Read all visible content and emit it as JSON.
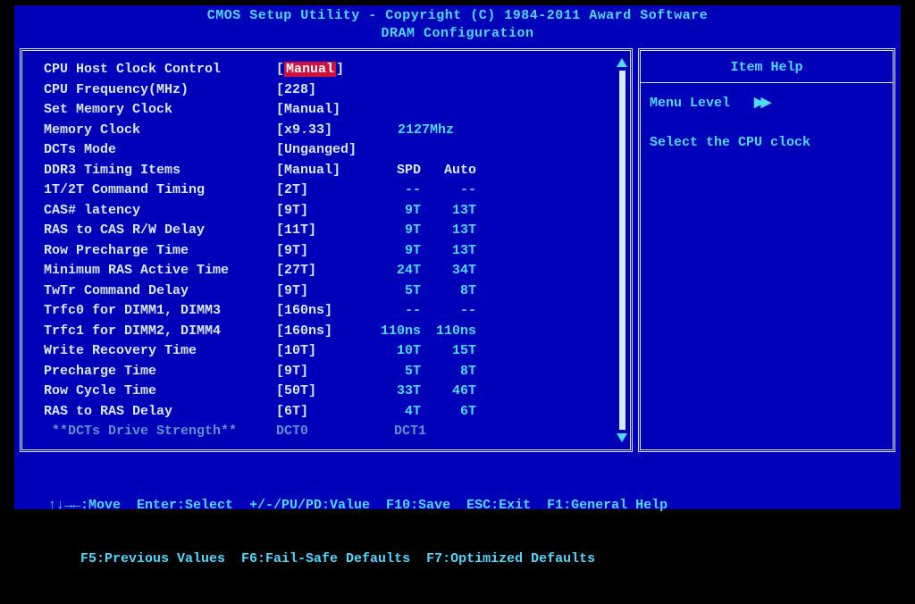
{
  "header": {
    "line1": "CMOS Setup Utility - Copyright (C) 1984-2011 Award Software",
    "line2": "DRAM Configuration"
  },
  "help": {
    "title": "Item Help",
    "menu_level": "Menu Level",
    "desc": "Select the CPU clock"
  },
  "headers": {
    "spd": "SPD",
    "auto": "Auto"
  },
  "clock_label": "2127Mhz",
  "dim_row": {
    "label": " **DCTs Drive Strength**",
    "c1": "DCT0",
    "c2": "DCT1"
  },
  "rows": [
    {
      "label": "CPU Host Clock Control",
      "value_pre": "[",
      "value_hl": "Manual",
      "value_post": "]",
      "spd": "",
      "auto": ""
    },
    {
      "label": "CPU Frequency(MHz)",
      "value": "[228]",
      "spd": "",
      "auto": ""
    },
    {
      "label": "Set Memory Clock",
      "value": "[Manual]",
      "spd": "",
      "auto": ""
    },
    {
      "label": "Memory Clock",
      "value": "[x9.33]",
      "clock": true
    },
    {
      "label": "DCTs Mode",
      "value": "[Unganged]",
      "spd": "",
      "auto": ""
    },
    {
      "label": "DDR3 Timing Items",
      "value": "[Manual]",
      "hdr": true
    },
    {
      "label": "1T/2T Command Timing",
      "value": "[2T]",
      "spd": "--",
      "auto": "--"
    },
    {
      "label": "CAS# latency",
      "value": "[9T]",
      "spd": "9T",
      "auto": "13T"
    },
    {
      "label": "RAS to CAS R/W Delay",
      "value": "[11T]",
      "spd": "9T",
      "auto": "13T"
    },
    {
      "label": "Row Precharge Time",
      "value": "[9T]",
      "spd": "9T",
      "auto": "13T"
    },
    {
      "label": "Minimum RAS Active Time",
      "value": "[27T]",
      "spd": "24T",
      "auto": "34T"
    },
    {
      "label": "TwTr Command Delay",
      "value": "[9T]",
      "spd": "5T",
      "auto": "8T"
    },
    {
      "label": "Trfc0 for DIMM1, DIMM3",
      "value": "[160ns]",
      "spd": "--",
      "auto": "--"
    },
    {
      "label": "Trfc1 for DIMM2, DIMM4",
      "value": "[160ns]",
      "spd": "110ns",
      "auto": "110ns"
    },
    {
      "label": "Write Recovery Time",
      "value": "[10T]",
      "spd": "10T",
      "auto": "15T"
    },
    {
      "label": "Precharge Time",
      "value": "[9T]",
      "spd": "5T",
      "auto": "8T"
    },
    {
      "label": "Row Cycle Time",
      "value": "[50T]",
      "spd": "33T",
      "auto": "46T"
    },
    {
      "label": "RAS to RAS Delay",
      "value": "[6T]",
      "spd": "4T",
      "auto": "6T"
    }
  ],
  "footer": {
    "line1": "↑↓→←:Move  Enter:Select  +/-/PU/PD:Value  F10:Save  ESC:Exit  F1:General Help",
    "line2": "    F5:Previous Values  F6:Fail-Safe Defaults  F7:Optimized Defaults"
  }
}
